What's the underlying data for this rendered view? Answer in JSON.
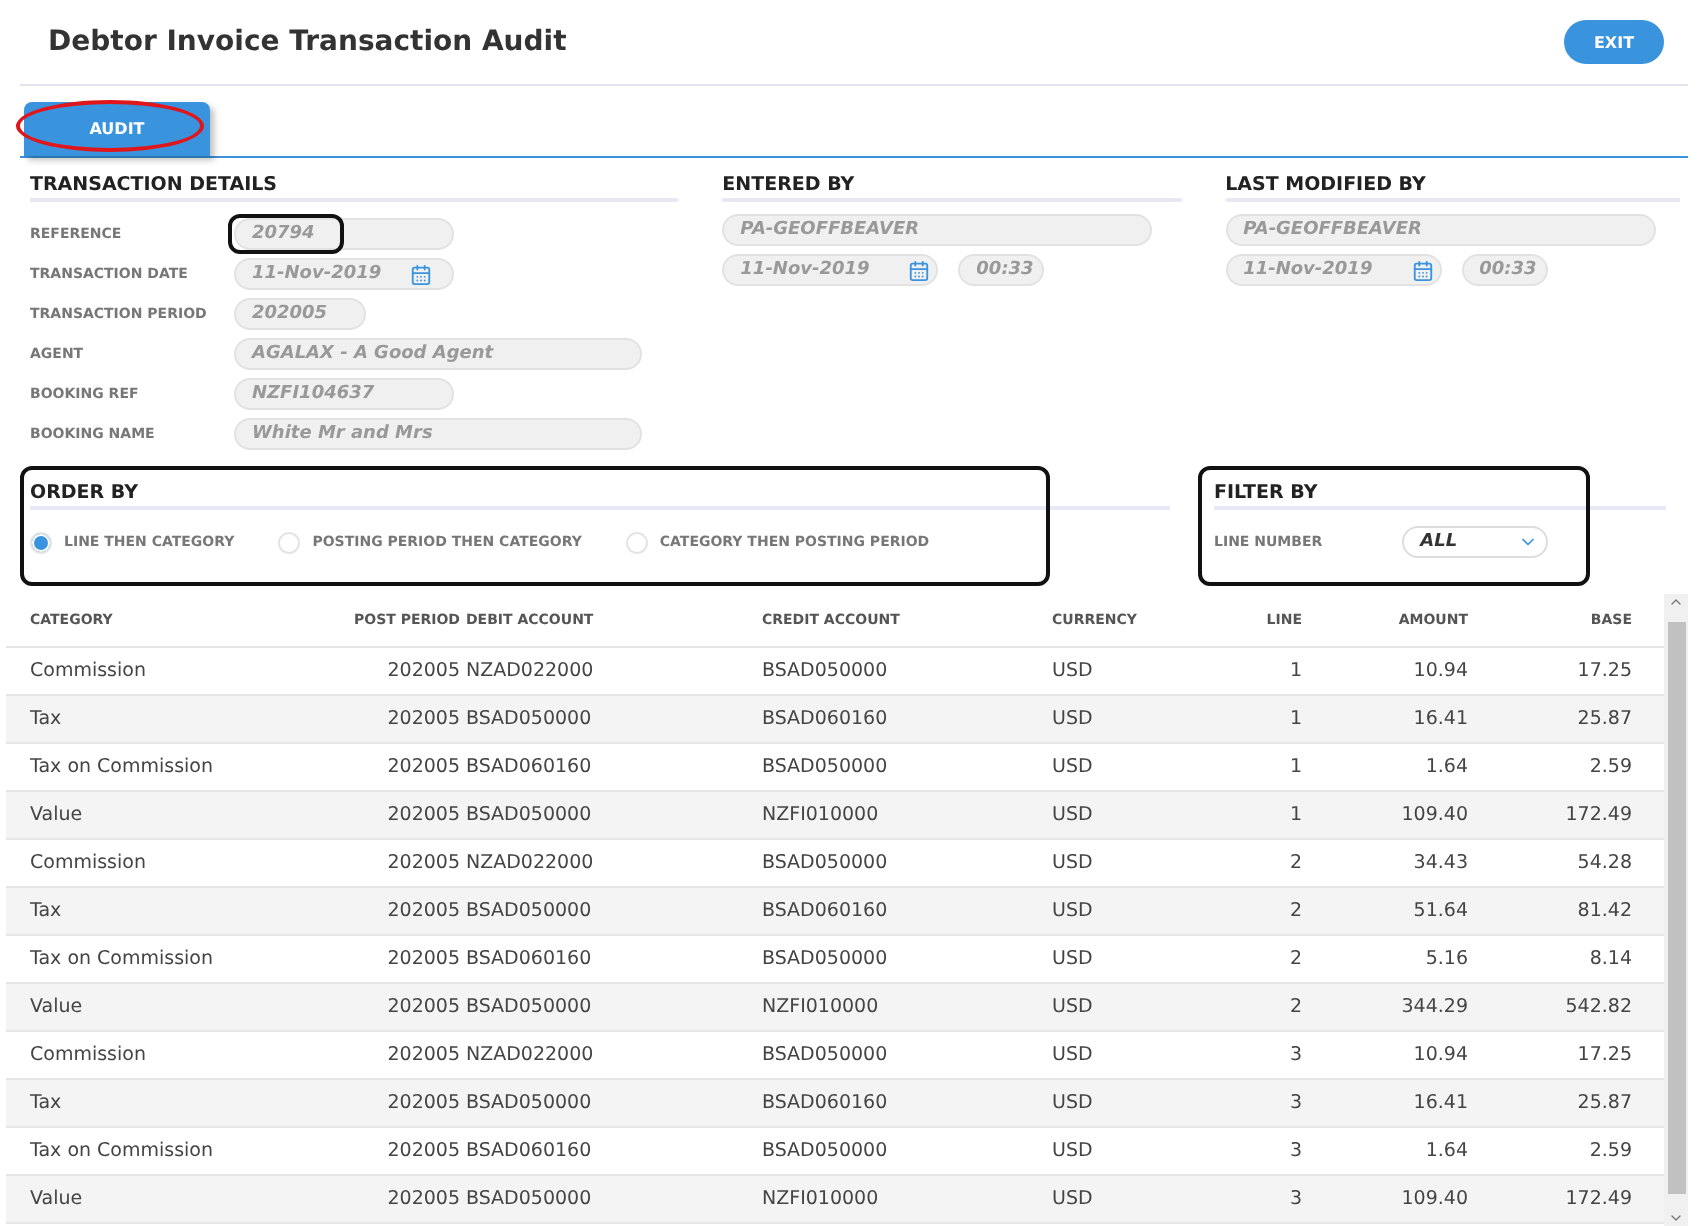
{
  "title": "Debtor Invoice Transaction Audit",
  "exit_button": "EXIT",
  "tabs": [
    {
      "label": "AUDIT",
      "selected": true,
      "highlighted": true
    }
  ],
  "transaction_details": {
    "heading": "TRANSACTION DETAILS",
    "fields": [
      {
        "label": "REFERENCE",
        "value": "20794",
        "kind": "short",
        "highlighted": true
      },
      {
        "label": "TRANSACTION DATE",
        "value": "11-Nov-2019",
        "kind": "date",
        "highlighted": false
      },
      {
        "label": "TRANSACTION PERIOD",
        "value": "202005",
        "kind": "tiny",
        "highlighted": false
      },
      {
        "label": "AGENT",
        "value": "AGALAX - A Good Agent",
        "kind": "long",
        "highlighted": false
      },
      {
        "label": "BOOKING REF",
        "value": "NZFI104637",
        "kind": "short",
        "highlighted": false
      },
      {
        "label": "BOOKING NAME",
        "value": "White Mr and Mrs",
        "kind": "long",
        "highlighted": false
      }
    ]
  },
  "entered_by": {
    "heading": "ENTERED BY",
    "user": "PA-GEOFFBEAVER",
    "date": "11-Nov-2019",
    "time": "00:33"
  },
  "last_modified_by": {
    "heading": "LAST MODIFIED BY",
    "user": "PA-GEOFFBEAVER",
    "date": "11-Nov-2019",
    "time": "00:33"
  },
  "order_by": {
    "heading": "ORDER BY",
    "highlighted": true,
    "options": [
      {
        "label": "LINE THEN CATEGORY",
        "selected": true
      },
      {
        "label": "POSTING PERIOD THEN CATEGORY",
        "selected": false
      },
      {
        "label": "CATEGORY THEN POSTING PERIOD",
        "selected": false
      }
    ]
  },
  "filter_by": {
    "heading": "FILTER BY",
    "highlighted": true,
    "label": "LINE NUMBER",
    "value": "ALL"
  },
  "table": {
    "columns": [
      "CATEGORY",
      "POST PERIOD",
      "DEBIT ACCOUNT",
      "CREDIT ACCOUNT",
      "CURRENCY",
      "LINE",
      "AMOUNT",
      "BASE"
    ],
    "rows": [
      [
        "Commission",
        "202005",
        "NZAD022000",
        "BSAD050000",
        "USD",
        "1",
        "10.94",
        "17.25"
      ],
      [
        "Tax",
        "202005",
        "BSAD050000",
        "BSAD060160",
        "USD",
        "1",
        "16.41",
        "25.87"
      ],
      [
        "Tax on Commission",
        "202005",
        "BSAD060160",
        "BSAD050000",
        "USD",
        "1",
        "1.64",
        "2.59"
      ],
      [
        "Value",
        "202005",
        "BSAD050000",
        "NZFI010000",
        "USD",
        "1",
        "109.40",
        "172.49"
      ],
      [
        "Commission",
        "202005",
        "NZAD022000",
        "BSAD050000",
        "USD",
        "2",
        "34.43",
        "54.28"
      ],
      [
        "Tax",
        "202005",
        "BSAD050000",
        "BSAD060160",
        "USD",
        "2",
        "51.64",
        "81.42"
      ],
      [
        "Tax on Commission",
        "202005",
        "BSAD060160",
        "BSAD050000",
        "USD",
        "2",
        "5.16",
        "8.14"
      ],
      [
        "Value",
        "202005",
        "BSAD050000",
        "NZFI010000",
        "USD",
        "2",
        "344.29",
        "542.82"
      ],
      [
        "Commission",
        "202005",
        "NZAD022000",
        "BSAD050000",
        "USD",
        "3",
        "10.94",
        "17.25"
      ],
      [
        "Tax",
        "202005",
        "BSAD050000",
        "BSAD060160",
        "USD",
        "3",
        "16.41",
        "25.87"
      ],
      [
        "Tax on Commission",
        "202005",
        "BSAD060160",
        "BSAD050000",
        "USD",
        "3",
        "1.64",
        "2.59"
      ],
      [
        "Value",
        "202005",
        "BSAD050000",
        "NZFI010000",
        "USD",
        "3",
        "109.40",
        "172.49"
      ]
    ]
  }
}
